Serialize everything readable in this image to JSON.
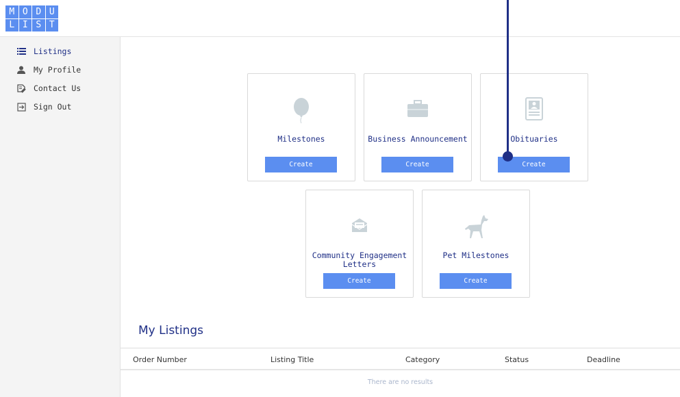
{
  "logo": {
    "letters": [
      "M",
      "O",
      "D",
      "U",
      "L",
      "I",
      "S",
      "T"
    ]
  },
  "sidebar": {
    "items": [
      {
        "label": "Listings",
        "icon": "list-icon",
        "active": true
      },
      {
        "label": "My Profile",
        "icon": "person-icon",
        "active": false
      },
      {
        "label": "Contact Us",
        "icon": "edit-note-icon",
        "active": false
      },
      {
        "label": "Sign Out",
        "icon": "sign-out-icon",
        "active": false
      }
    ]
  },
  "cards": [
    {
      "title": "Milestones",
      "icon": "balloon-icon",
      "button": "Create"
    },
    {
      "title": "Business Announcement",
      "icon": "briefcase-icon",
      "button": "Create"
    },
    {
      "title": "Obituaries",
      "icon": "document-person-icon",
      "button": "Create"
    },
    {
      "title": "Community Engagement Letters",
      "icon": "envelope-icon",
      "button": "Create"
    },
    {
      "title": "Pet Milestones",
      "icon": "dog-icon",
      "button": "Create"
    }
  ],
  "listings": {
    "title": "My Listings",
    "columns": [
      "Order Number",
      "Listing Title",
      "Category",
      "Status",
      "Deadline"
    ],
    "empty_text": "There are no results"
  },
  "colors": {
    "accent": "#5b8ef0",
    "brand_text": "#1f2f86",
    "card_icon": "#c9d3d8"
  }
}
